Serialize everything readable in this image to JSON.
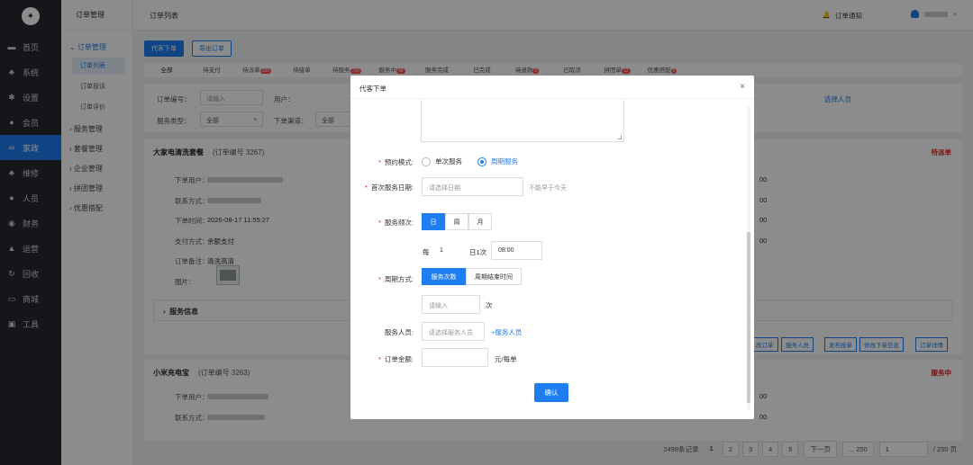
{
  "sidebar": {
    "items": [
      {
        "icon": "monitor-icon",
        "label": "首页"
      },
      {
        "icon": "org-icon",
        "label": "系统"
      },
      {
        "icon": "gear-icon",
        "label": "设置"
      },
      {
        "icon": "user-icon",
        "label": "会员"
      },
      {
        "icon": "link-icon",
        "label": "家政"
      },
      {
        "icon": "org-icon",
        "label": "维修"
      },
      {
        "icon": "user-icon",
        "label": "人员"
      },
      {
        "icon": "money-icon",
        "label": "财务"
      },
      {
        "icon": "chart-icon",
        "label": "运营"
      },
      {
        "icon": "recycle-icon",
        "label": "回收"
      },
      {
        "icon": "store-icon",
        "label": "商城"
      },
      {
        "icon": "toolbox-icon",
        "label": "工具"
      }
    ]
  },
  "submenu": {
    "title": "订单管理",
    "group_open": "订单管理",
    "leaves": [
      "订单列表",
      "订单投诉",
      "订单评价"
    ],
    "groups": [
      "服务管理",
      "套餐管理",
      "企业管理",
      "拼团管理",
      "优惠搭配"
    ]
  },
  "topbar": {
    "breadcrumb": "订单列表",
    "notice": "订单通知"
  },
  "toolbar": {
    "create_label": "代客下单",
    "export_label": "导出订单"
  },
  "tabs": [
    {
      "label": "全部",
      "badge": ""
    },
    {
      "label": "待支付",
      "badge": ""
    },
    {
      "label": "待派单",
      "badge": "229"
    },
    {
      "label": "待接单",
      "badge": ""
    },
    {
      "label": "待服务",
      "badge": "720"
    },
    {
      "label": "服务中",
      "badge": "48"
    },
    {
      "label": "服务完成",
      "badge": ""
    },
    {
      "label": "已完成",
      "badge": ""
    },
    {
      "label": "待退款",
      "badge": "0"
    },
    {
      "label": "已取消",
      "badge": ""
    },
    {
      "label": "拼团单",
      "badge": "12"
    },
    {
      "label": "优惠搭配",
      "badge": "0"
    }
  ],
  "filter": {
    "order_no_label": "订单编号：",
    "order_no_placeholder": "请输入",
    "user_label": "用户：",
    "service_type_label": "服务类型：",
    "service_type_value": "全部",
    "channel_label": "下单渠道：",
    "channel_value": "全部",
    "pick_staff": "选择人员"
  },
  "orders": [
    {
      "title": "大家电清洗套餐",
      "order_no": "(订单编号 3267)",
      "status": "待派单",
      "rows": [
        {
          "label": "下单用户：",
          "value": ""
        },
        {
          "label": "联系方式：",
          "value": ""
        },
        {
          "label": "下单时间：",
          "value": "2026-08-17 11:55:27"
        },
        {
          "label": "支付方式：",
          "value": "余额支付"
        },
        {
          "label": "订单备注：",
          "value": "清洗高清"
        },
        {
          "label": "图片：",
          "value": ""
        }
      ],
      "right_values": [
        "00",
        "00",
        "00",
        "00"
      ],
      "section": "服务信息",
      "actions": [
        "改订单",
        "服务人员",
        "发布抢单",
        "修改下单信息",
        "订单详情"
      ]
    },
    {
      "title": "小米充电宝",
      "order_no": "(订单编号 3263)",
      "status": "服务中",
      "rows": [
        {
          "label": "下单用户：",
          "value": ""
        },
        {
          "label": "联系方式：",
          "value": ""
        }
      ],
      "right_values": [
        "00",
        "00"
      ]
    }
  ],
  "pager": {
    "total": "2498条记录",
    "pages": [
      "1",
      "2",
      "3",
      "4",
      "5"
    ],
    "next": "下一页",
    "last": "... 250",
    "jump_value": "1",
    "jump_total": "/ 250 页"
  },
  "modal": {
    "title": "代客下单",
    "close": "×",
    "mode_label": "预约模式:",
    "mode_options": [
      "单次服务",
      "周期服务"
    ],
    "first_date_label": "首次服务日期:",
    "first_date_placeholder": "请选择日期",
    "first_date_hint": "不能早于今天",
    "freq_label": "服务频次:",
    "freq_options": [
      "日",
      "周",
      "月"
    ],
    "every_prefix": "每",
    "every_value": "1",
    "every_suffix": "日1次",
    "time_value": "08:00",
    "cycle_label": "周期方式:",
    "cycle_options": [
      "服务次数",
      "周期结束时间"
    ],
    "count_placeholder": "请输入",
    "count_unit": "次",
    "staff_label": "服务人员:",
    "staff_placeholder": "请选择服务人员",
    "staff_add": "+服务人员",
    "amount_label": "订单金额:",
    "amount_unit": "元/每单",
    "confirm": "确认"
  },
  "colors": {
    "accent": "#1e7df0",
    "danger": "#e02020",
    "sidebar": "#25292f"
  }
}
